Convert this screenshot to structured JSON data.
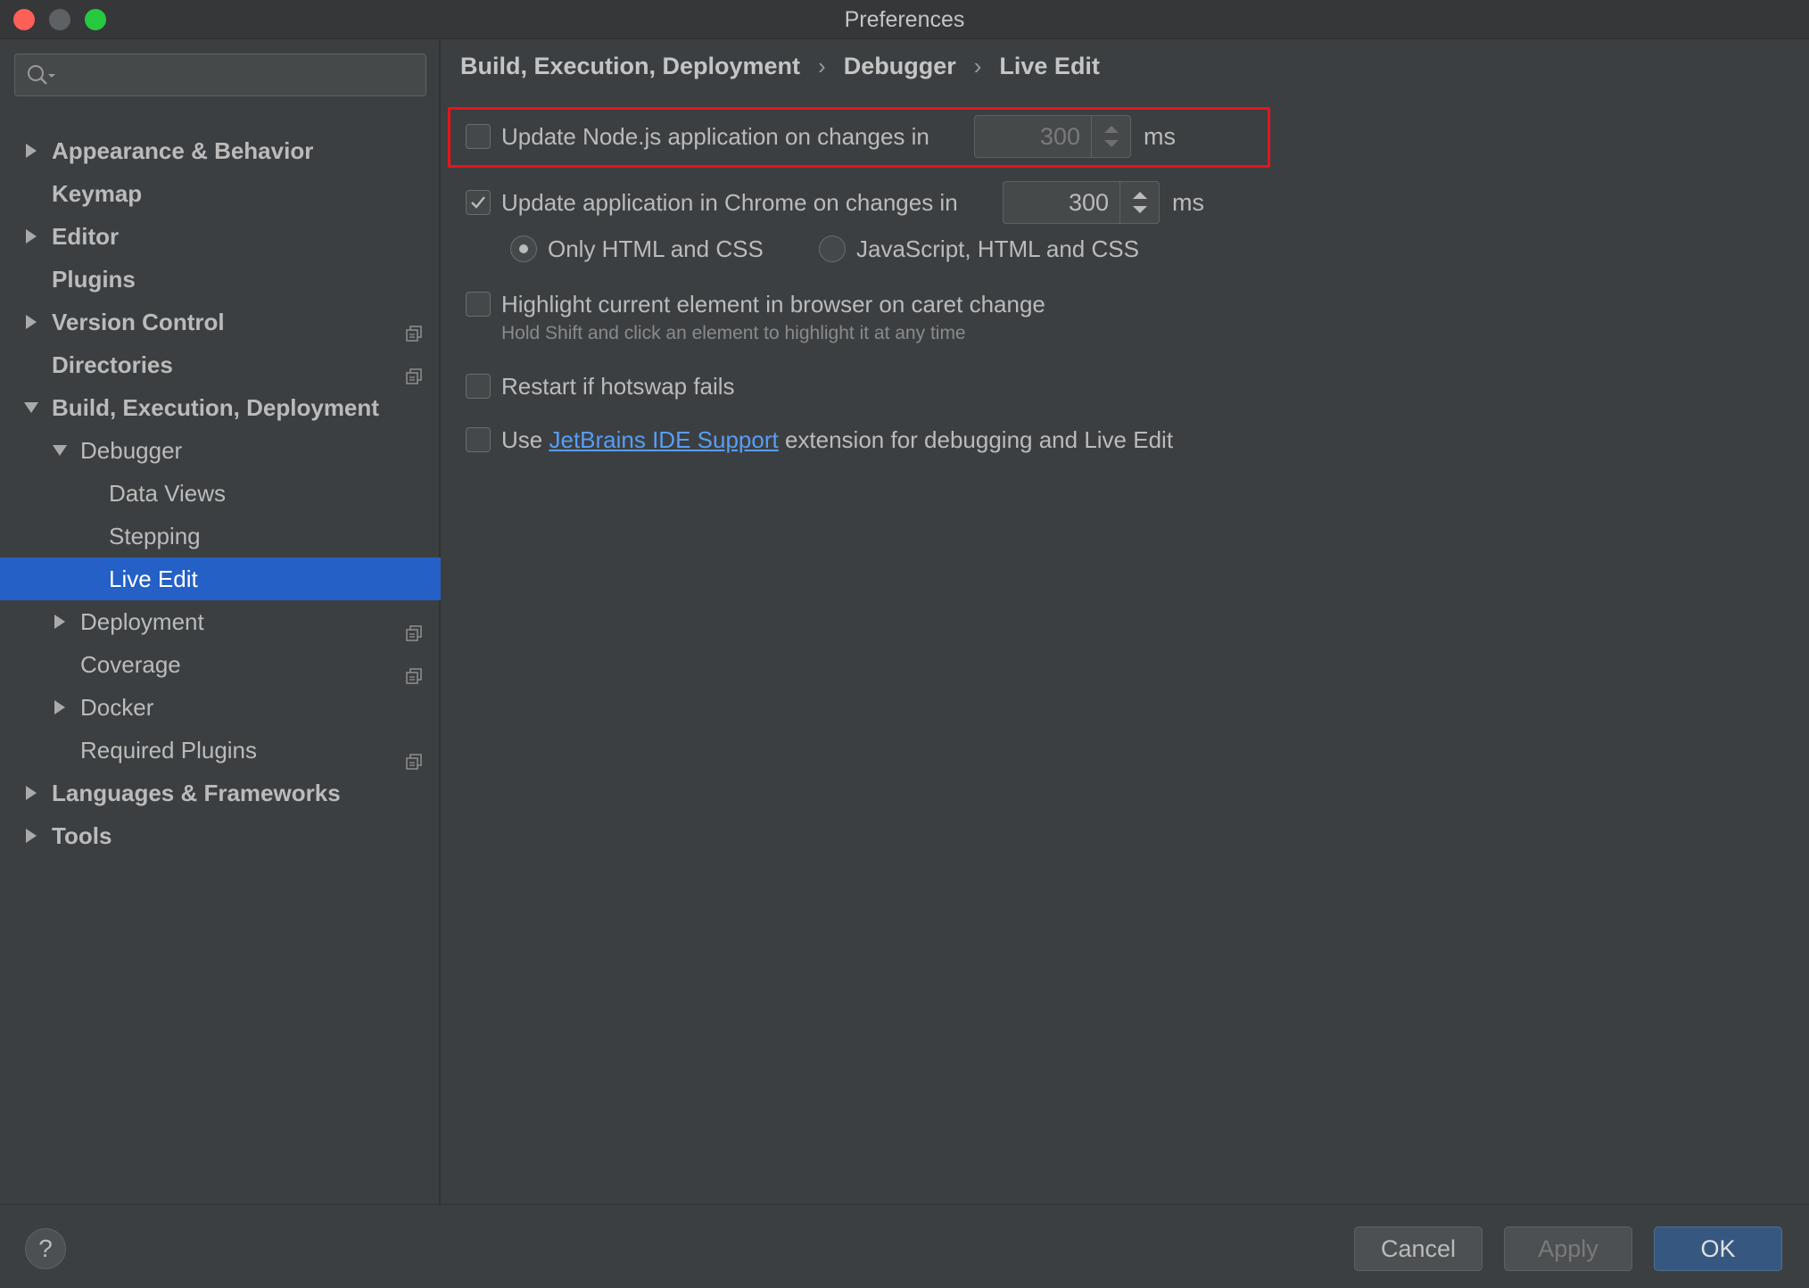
{
  "window": {
    "title": "Preferences"
  },
  "search": {
    "placeholder": ""
  },
  "sidebar": {
    "items": [
      {
        "label": "Appearance & Behavior",
        "bold": true,
        "expandable": true,
        "expanded": false
      },
      {
        "label": "Keymap",
        "bold": true
      },
      {
        "label": "Editor",
        "bold": true,
        "expandable": true,
        "expanded": false
      },
      {
        "label": "Plugins",
        "bold": true
      },
      {
        "label": "Version Control",
        "bold": true,
        "expandable": true,
        "expanded": false,
        "project_icon": true
      },
      {
        "label": "Directories",
        "bold": true,
        "project_icon": true
      },
      {
        "label": "Build, Execution, Deployment",
        "bold": true,
        "expandable": true,
        "expanded": true
      },
      {
        "label": "Debugger",
        "expandable": true,
        "expanded": true
      },
      {
        "label": "Data Views"
      },
      {
        "label": "Stepping"
      },
      {
        "label": "Live Edit",
        "selected": true
      },
      {
        "label": "Deployment",
        "expandable": true,
        "expanded": false,
        "project_icon": true
      },
      {
        "label": "Coverage",
        "project_icon": true
      },
      {
        "label": "Docker",
        "expandable": true,
        "expanded": false
      },
      {
        "label": "Required Plugins",
        "project_icon": true
      },
      {
        "label": "Languages & Frameworks",
        "bold": true,
        "expandable": true,
        "expanded": false
      },
      {
        "label": "Tools",
        "bold": true,
        "expandable": true,
        "expanded": false
      }
    ]
  },
  "breadcrumb": [
    "Build, Execution, Deployment",
    "Debugger",
    "Live Edit"
  ],
  "settings": {
    "node_update": {
      "label": "Update Node.js application on changes in",
      "checked": false,
      "value": "300",
      "unit": "ms"
    },
    "chrome_update": {
      "label": "Update application in Chrome on changes in",
      "checked": true,
      "value": "300",
      "unit": "ms"
    },
    "radio_html_css": {
      "label": "Only HTML and CSS",
      "selected": true
    },
    "radio_js_html_css": {
      "label": "JavaScript, HTML and CSS",
      "selected": false
    },
    "highlight": {
      "label": "Highlight current element in browser on caret change",
      "checked": false,
      "hint": "Hold Shift and click an element to highlight it at any time"
    },
    "restart": {
      "label": "Restart if hotswap fails",
      "checked": false
    },
    "jetbrains": {
      "prefix": "Use",
      "link": "JetBrains IDE Support",
      "suffix": "extension for debugging and Live Edit",
      "checked": false
    }
  },
  "footer": {
    "help": "?",
    "cancel": "Cancel",
    "apply": "Apply",
    "ok": "OK"
  },
  "colors": {
    "selection": "#2460c6",
    "highlight_box": "#e8141b",
    "link": "#589df6",
    "ok_button": "#365880"
  }
}
